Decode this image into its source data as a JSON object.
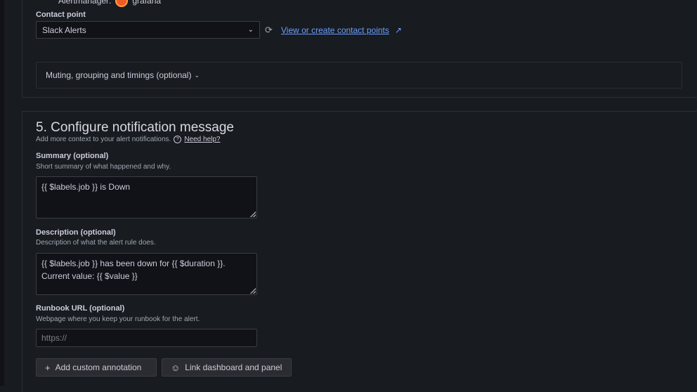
{
  "alertmanager": {
    "label": "Alertmanager:",
    "name": "grafana"
  },
  "contact_point": {
    "label": "Contact point",
    "selected": "Slack Alerts",
    "link": "View or create contact points"
  },
  "muting": {
    "label": "Muting, grouping and timings (optional)"
  },
  "notification": {
    "heading": "5. Configure notification message",
    "subtitle": "Add more context to your alert notifications.",
    "help_link": "Need help?"
  },
  "summary": {
    "label": "Summary (optional)",
    "description": "Short summary of what happened and why.",
    "value": "{{ $labels.job }} is Down"
  },
  "description": {
    "label": "Description (optional)",
    "description": "Description of what the alert rule does.",
    "value_line1": "{{ $labels.job }} has been down for {{ $duration }}.",
    "value_line2": "Current value: {{ $value }}"
  },
  "runbook": {
    "label": "Runbook URL (optional)",
    "description": "Webpage where you keep your runbook for the alert.",
    "placeholder": "https://"
  },
  "buttons": {
    "add_annotation": "Add custom annotation",
    "link_dashboard": "Link dashboard and panel"
  },
  "icons": {
    "chevron": "chevron-down-icon",
    "refresh": "refresh-icon",
    "external": "external-link-icon",
    "help": "question-circle-icon",
    "plus": "plus-icon",
    "dashboard": "dashboard-link-icon"
  },
  "colors": {
    "link": "#6e9fff",
    "background": "#181b1f"
  }
}
